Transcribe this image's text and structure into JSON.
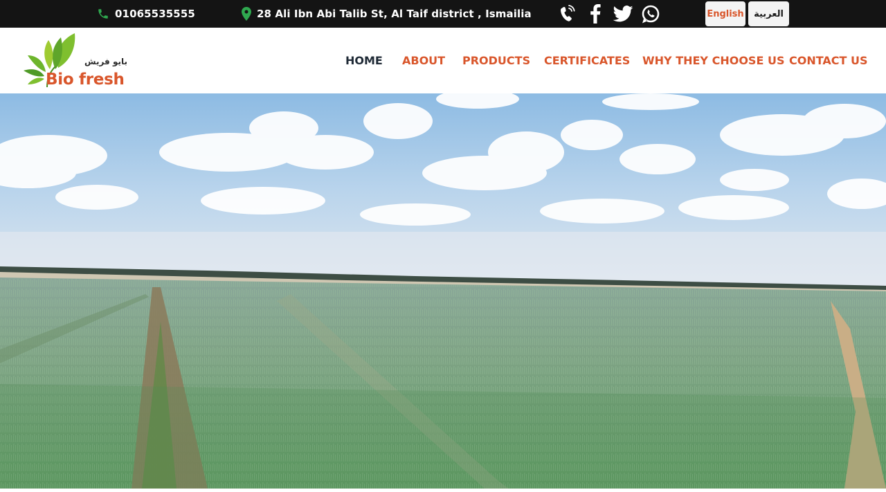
{
  "topbar": {
    "phone": "01065535555",
    "address": "28 Ali Ibn Abi Talib St, Al Taif district , Ismailia",
    "social_icons": [
      "phone-call-icon",
      "facebook-icon",
      "twitter-icon",
      "whatsapp-icon"
    ],
    "languages": {
      "english": "English",
      "arabic": "العربية"
    }
  },
  "brand": {
    "name_en": "Bio fresh",
    "name_ar": "بايو فريش",
    "logo_icon": "leaves-logo-icon"
  },
  "nav": {
    "items": [
      "HOME",
      "ABOUT",
      "PRODUCTS",
      "CERTIFICATES",
      "WHY THEY CHOOSE US",
      "CONTACT US"
    ],
    "active": "HOME"
  },
  "hero": {
    "image": "green onion field under a cloudy blue sky"
  },
  "colors": {
    "topbar_bg": "#141414",
    "accent": "#d9562b",
    "nav_active": "#1f2a36",
    "icon_green": "#2fa84f"
  }
}
